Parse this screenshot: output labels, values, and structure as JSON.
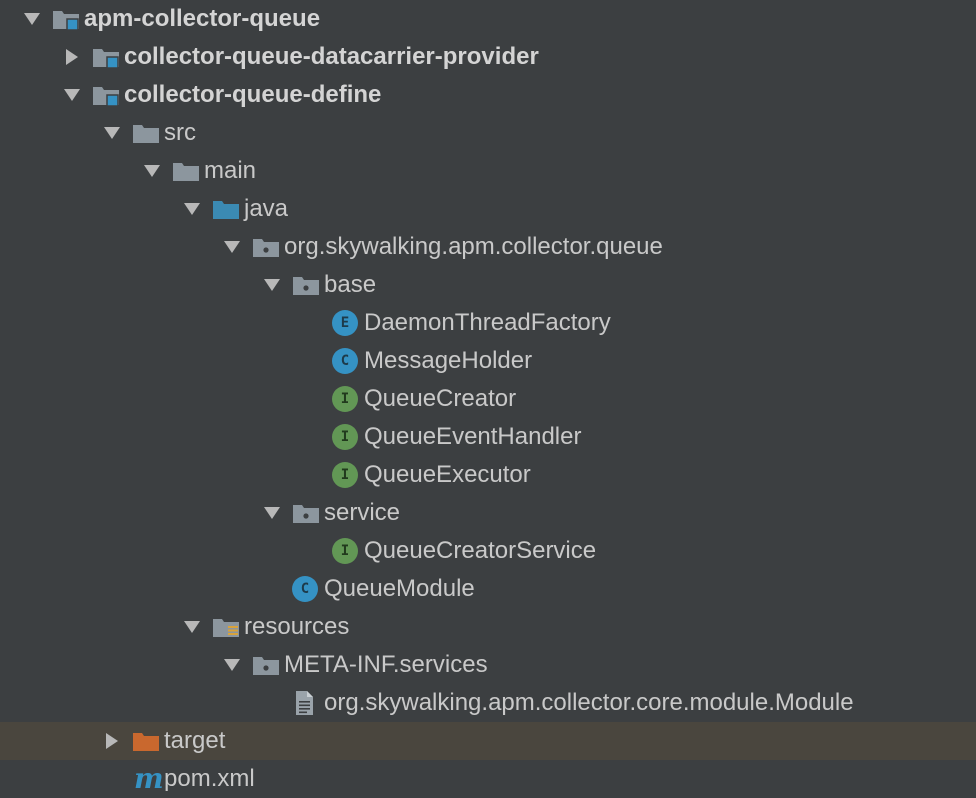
{
  "tree": [
    {
      "label": "apm-collector-queue",
      "depth": 0,
      "arrow": "down",
      "icon": "module-folder-icon",
      "bold": true
    },
    {
      "label": "collector-queue-datacarrier-provider",
      "depth": 1,
      "arrow": "right",
      "icon": "module-folder-icon",
      "bold": true
    },
    {
      "label": "collector-queue-define",
      "depth": 1,
      "arrow": "down",
      "icon": "module-folder-icon",
      "bold": true
    },
    {
      "label": "src",
      "depth": 2,
      "arrow": "down",
      "icon": "folder-icon"
    },
    {
      "label": "main",
      "depth": 3,
      "arrow": "down",
      "icon": "folder-icon"
    },
    {
      "label": "java",
      "depth": 4,
      "arrow": "down",
      "icon": "source-folder-icon"
    },
    {
      "label": "org.skywalking.apm.collector.queue",
      "depth": 5,
      "arrow": "down",
      "icon": "package-icon"
    },
    {
      "label": "base",
      "depth": 6,
      "arrow": "down",
      "icon": "package-icon"
    },
    {
      "label": "DaemonThreadFactory",
      "depth": 7,
      "arrow": "none",
      "icon": "enum-icon",
      "badge": "E"
    },
    {
      "label": "MessageHolder",
      "depth": 7,
      "arrow": "none",
      "icon": "class-icon",
      "badge": "C"
    },
    {
      "label": "QueueCreator",
      "depth": 7,
      "arrow": "none",
      "icon": "interface-icon",
      "badge": "I"
    },
    {
      "label": "QueueEventHandler",
      "depth": 7,
      "arrow": "none",
      "icon": "interface-icon",
      "badge": "I"
    },
    {
      "label": "QueueExecutor",
      "depth": 7,
      "arrow": "none",
      "icon": "interface-icon",
      "badge": "I"
    },
    {
      "label": "service",
      "depth": 6,
      "arrow": "down",
      "icon": "package-icon"
    },
    {
      "label": "QueueCreatorService",
      "depth": 7,
      "arrow": "none",
      "icon": "interface-icon",
      "badge": "I"
    },
    {
      "label": "QueueModule",
      "depth": 6,
      "arrow": "none",
      "icon": "class-icon",
      "badge": "C"
    },
    {
      "label": "resources",
      "depth": 4,
      "arrow": "down",
      "icon": "resources-folder-icon"
    },
    {
      "label": "META-INF.services",
      "depth": 5,
      "arrow": "down",
      "icon": "package-icon"
    },
    {
      "label": "org.skywalking.apm.collector.core.module.Module",
      "depth": 6,
      "arrow": "none",
      "icon": "text-file-icon"
    },
    {
      "label": "target",
      "depth": 2,
      "arrow": "right",
      "icon": "excluded-folder-icon",
      "selected": true
    },
    {
      "label": "pom.xml",
      "depth": 2,
      "arrow": "none",
      "icon": "maven-pom-icon",
      "badge": "m"
    }
  ],
  "colors": {
    "background": "#3c3f41",
    "selected_row": "#4a463e",
    "folder_gray": "#8c969e",
    "source_folder_blue": "#3b8ab3",
    "module_square_blue": "#3592c4",
    "excluded_orange": "#c9682e",
    "class_blue": "#3592c4",
    "interface_green": "#629755",
    "arrow": "#b8b8b8"
  }
}
